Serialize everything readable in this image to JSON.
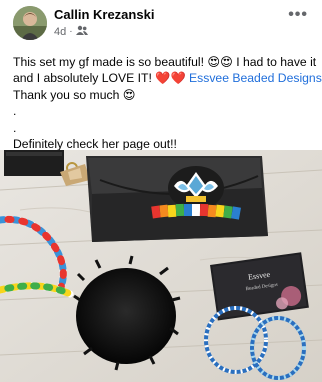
{
  "post": {
    "author": "Callin Krezanski",
    "time": "4d",
    "time_separator": "·",
    "audience_icon": "friends-icon",
    "more_label": "•••",
    "lines": {
      "l1a": "This set my gf made is so beautiful! ",
      "l1_emoji": "😍😍",
      "l1b": " I had to have it",
      "l2a": "and I absolutely LOVE IT! ",
      "l2_hearts": "❤️❤️",
      "l2_link": "Essvee Beaded Designs",
      "l3a": "Thank you so much ",
      "l3_emoji": "😍",
      "l4": ".",
      "l5": ".",
      "l6": "Definitely check her page out!!"
    }
  },
  "photo": {
    "card_brand": "Essvee",
    "card_sub": "Beaded Designs"
  }
}
